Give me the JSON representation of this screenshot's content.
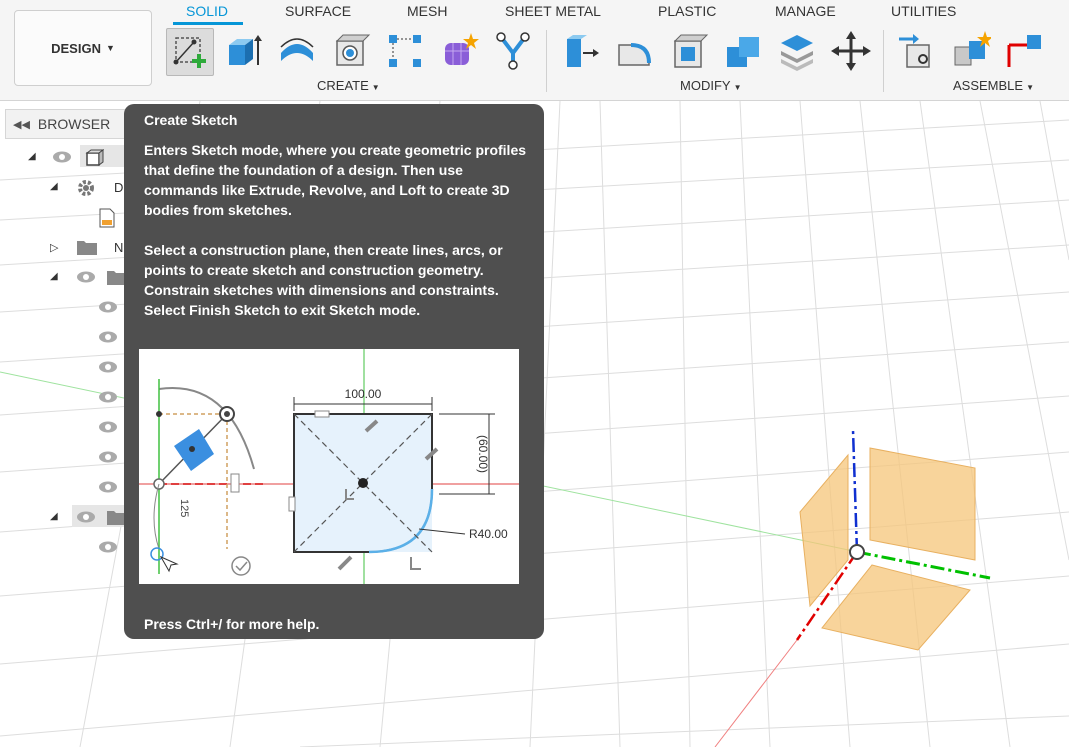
{
  "toolbar": {
    "workspace_label": "DESIGN",
    "tabs": [
      "SOLID",
      "SURFACE",
      "MESH",
      "SHEET METAL",
      "PLASTIC",
      "MANAGE",
      "UTILITIES"
    ],
    "active_tab": "SOLID",
    "groups": {
      "create": "CREATE",
      "modify": "MODIFY",
      "assemble": "ASSEMBLE"
    }
  },
  "browser": {
    "title": "BROWSER",
    "rows": [
      {
        "label": ""
      },
      {
        "label": "D"
      },
      {
        "label": ""
      },
      {
        "label": "N"
      }
    ]
  },
  "tooltip": {
    "title": "Create Sketch",
    "paragraph1": "Enters Sketch mode, where you create geometric profiles that define the foundation of a design. Then use commands like Extrude, Revolve, and Loft to create 3D bodies from sketches.",
    "paragraph2": "Select a construction plane, then create lines, arcs, or points to create sketch and construction geometry. Constrain sketches with dimensions and constraints. Select Finish Sketch to exit Sketch mode.",
    "footer": "Press Ctrl+/ for more help.",
    "image_labels": {
      "width_dim": "100.00",
      "height_dim": "(60.00)",
      "radius_dim": "R40.00",
      "angle_dim": "125"
    }
  },
  "colors": {
    "accent": "#0696d7",
    "tooltip_bg": "#4f4f4f",
    "x_axis": "#e00000",
    "y_axis": "#00c000",
    "z_axis": "#1030d0",
    "plane_fill": "#f6c57a"
  },
  "icons": {
    "create": [
      "create-sketch-icon",
      "extrude-icon",
      "revolve-icon",
      "hole-icon",
      "pattern-icon",
      "form-icon",
      "derive-icon"
    ],
    "modify": [
      "press-pull-icon",
      "fillet-icon",
      "shell-icon",
      "combine-icon",
      "offset-face-icon",
      "move-icon"
    ],
    "assemble": [
      "new-component-icon",
      "joint-icon",
      "as-built-joint-icon"
    ]
  }
}
